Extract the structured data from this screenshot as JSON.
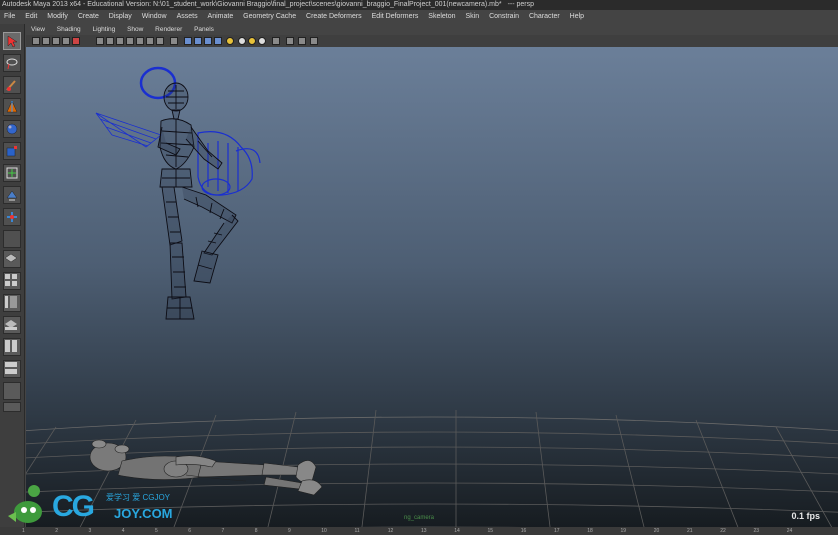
{
  "titlebar": {
    "title": "Autodesk Maya 2013 x64 - Educational Version: N:\\01_student_work\\Giovanni Braggio\\final_project\\scenes\\giovanni_braggio_FinalProject_001(newcamera).mb*",
    "pane": "---   persp"
  },
  "menus": [
    "File",
    "Edit",
    "Modify",
    "Create",
    "Display",
    "Window",
    "Assets",
    "Animate",
    "Geometry Cache",
    "Create Deformers",
    "Edit Deformers",
    "Skeleton",
    "Skin",
    "Constrain",
    "Character",
    "Help"
  ],
  "panel_menus": [
    "View",
    "Shading",
    "Lighting",
    "Show",
    "Renderer",
    "Panels"
  ],
  "toolbox": {
    "tools": [
      "select-tool-icon",
      "lasso-tool-icon",
      "paint-select-icon",
      "move-tool-icon",
      "rotate-tool-icon",
      "scale-tool-icon",
      "manipulator-icon",
      "soft-mod-icon",
      "show-manipulator-icon",
      "last-tool-icon"
    ],
    "layouts": [
      "single-pane-icon",
      "four-pane-icon",
      "outliner-layout-icon",
      "persp-layout-icon",
      "two-pane-icon",
      "hypershade-layout-icon",
      "graph-layout-icon",
      "more-icon"
    ]
  },
  "viewport": {
    "fps": "0.1 fps",
    "camera_label": "ng_camera"
  },
  "timeline": {
    "ticks": [
      "1",
      "2",
      "3",
      "4",
      "5",
      "6",
      "7",
      "8",
      "9",
      "10",
      "11",
      "12",
      "13",
      "14",
      "15",
      "16",
      "17",
      "18",
      "19",
      "20",
      "21",
      "22",
      "23",
      "24"
    ]
  },
  "watermark": {
    "logo": "CG",
    "domain": "JOY.COM",
    "tagline": "爱学习 爱 CGJOY"
  },
  "colors": {
    "wireframe_selected": "#1a2fd0",
    "accent_logo": "#29a8e0"
  }
}
